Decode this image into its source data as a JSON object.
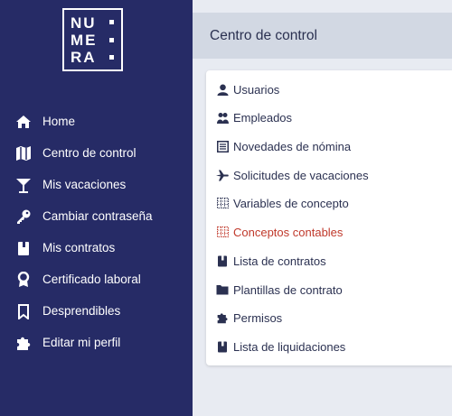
{
  "brand": {
    "logo_rows": [
      "NU",
      "ME",
      "RA"
    ],
    "colors": {
      "sidebar": "#262b66",
      "accent_active": "#c0392b",
      "topbar": "#d2d8e3",
      "text": "#2b3151"
    }
  },
  "sidebar": {
    "items": [
      {
        "label": "Home",
        "icon": "home-icon"
      },
      {
        "label": "Centro de control",
        "icon": "map-icon"
      },
      {
        "label": "Mis vacaciones",
        "icon": "cocktail-icon"
      },
      {
        "label": "Cambiar contraseña",
        "icon": "key-icon"
      },
      {
        "label": "Mis contratos",
        "icon": "book-icon"
      },
      {
        "label": "Certificado laboral",
        "icon": "award-icon"
      },
      {
        "label": "Desprendibles",
        "icon": "bookmark-icon"
      },
      {
        "label": "Editar mi perfil",
        "icon": "puzzle-icon"
      }
    ]
  },
  "header": {
    "title": "Centro de control"
  },
  "menu": {
    "active_index": 5,
    "items": [
      {
        "label": "Usuarios",
        "icon": "user-icon"
      },
      {
        "label": "Empleados",
        "icon": "users-icon"
      },
      {
        "label": "Novedades de nómina",
        "icon": "newspaper-icon"
      },
      {
        "label": "Solicitudes de vacaciones",
        "icon": "plane-icon"
      },
      {
        "label": "Variables de concepto",
        "icon": "table-icon"
      },
      {
        "label": "Conceptos contables",
        "icon": "table-icon"
      },
      {
        "label": "Lista de contratos",
        "icon": "book-icon"
      },
      {
        "label": "Plantillas de contrato",
        "icon": "folder-icon"
      },
      {
        "label": "Permisos",
        "icon": "puzzle-icon"
      },
      {
        "label": "Lista de liquidaciones",
        "icon": "book-icon"
      }
    ]
  }
}
